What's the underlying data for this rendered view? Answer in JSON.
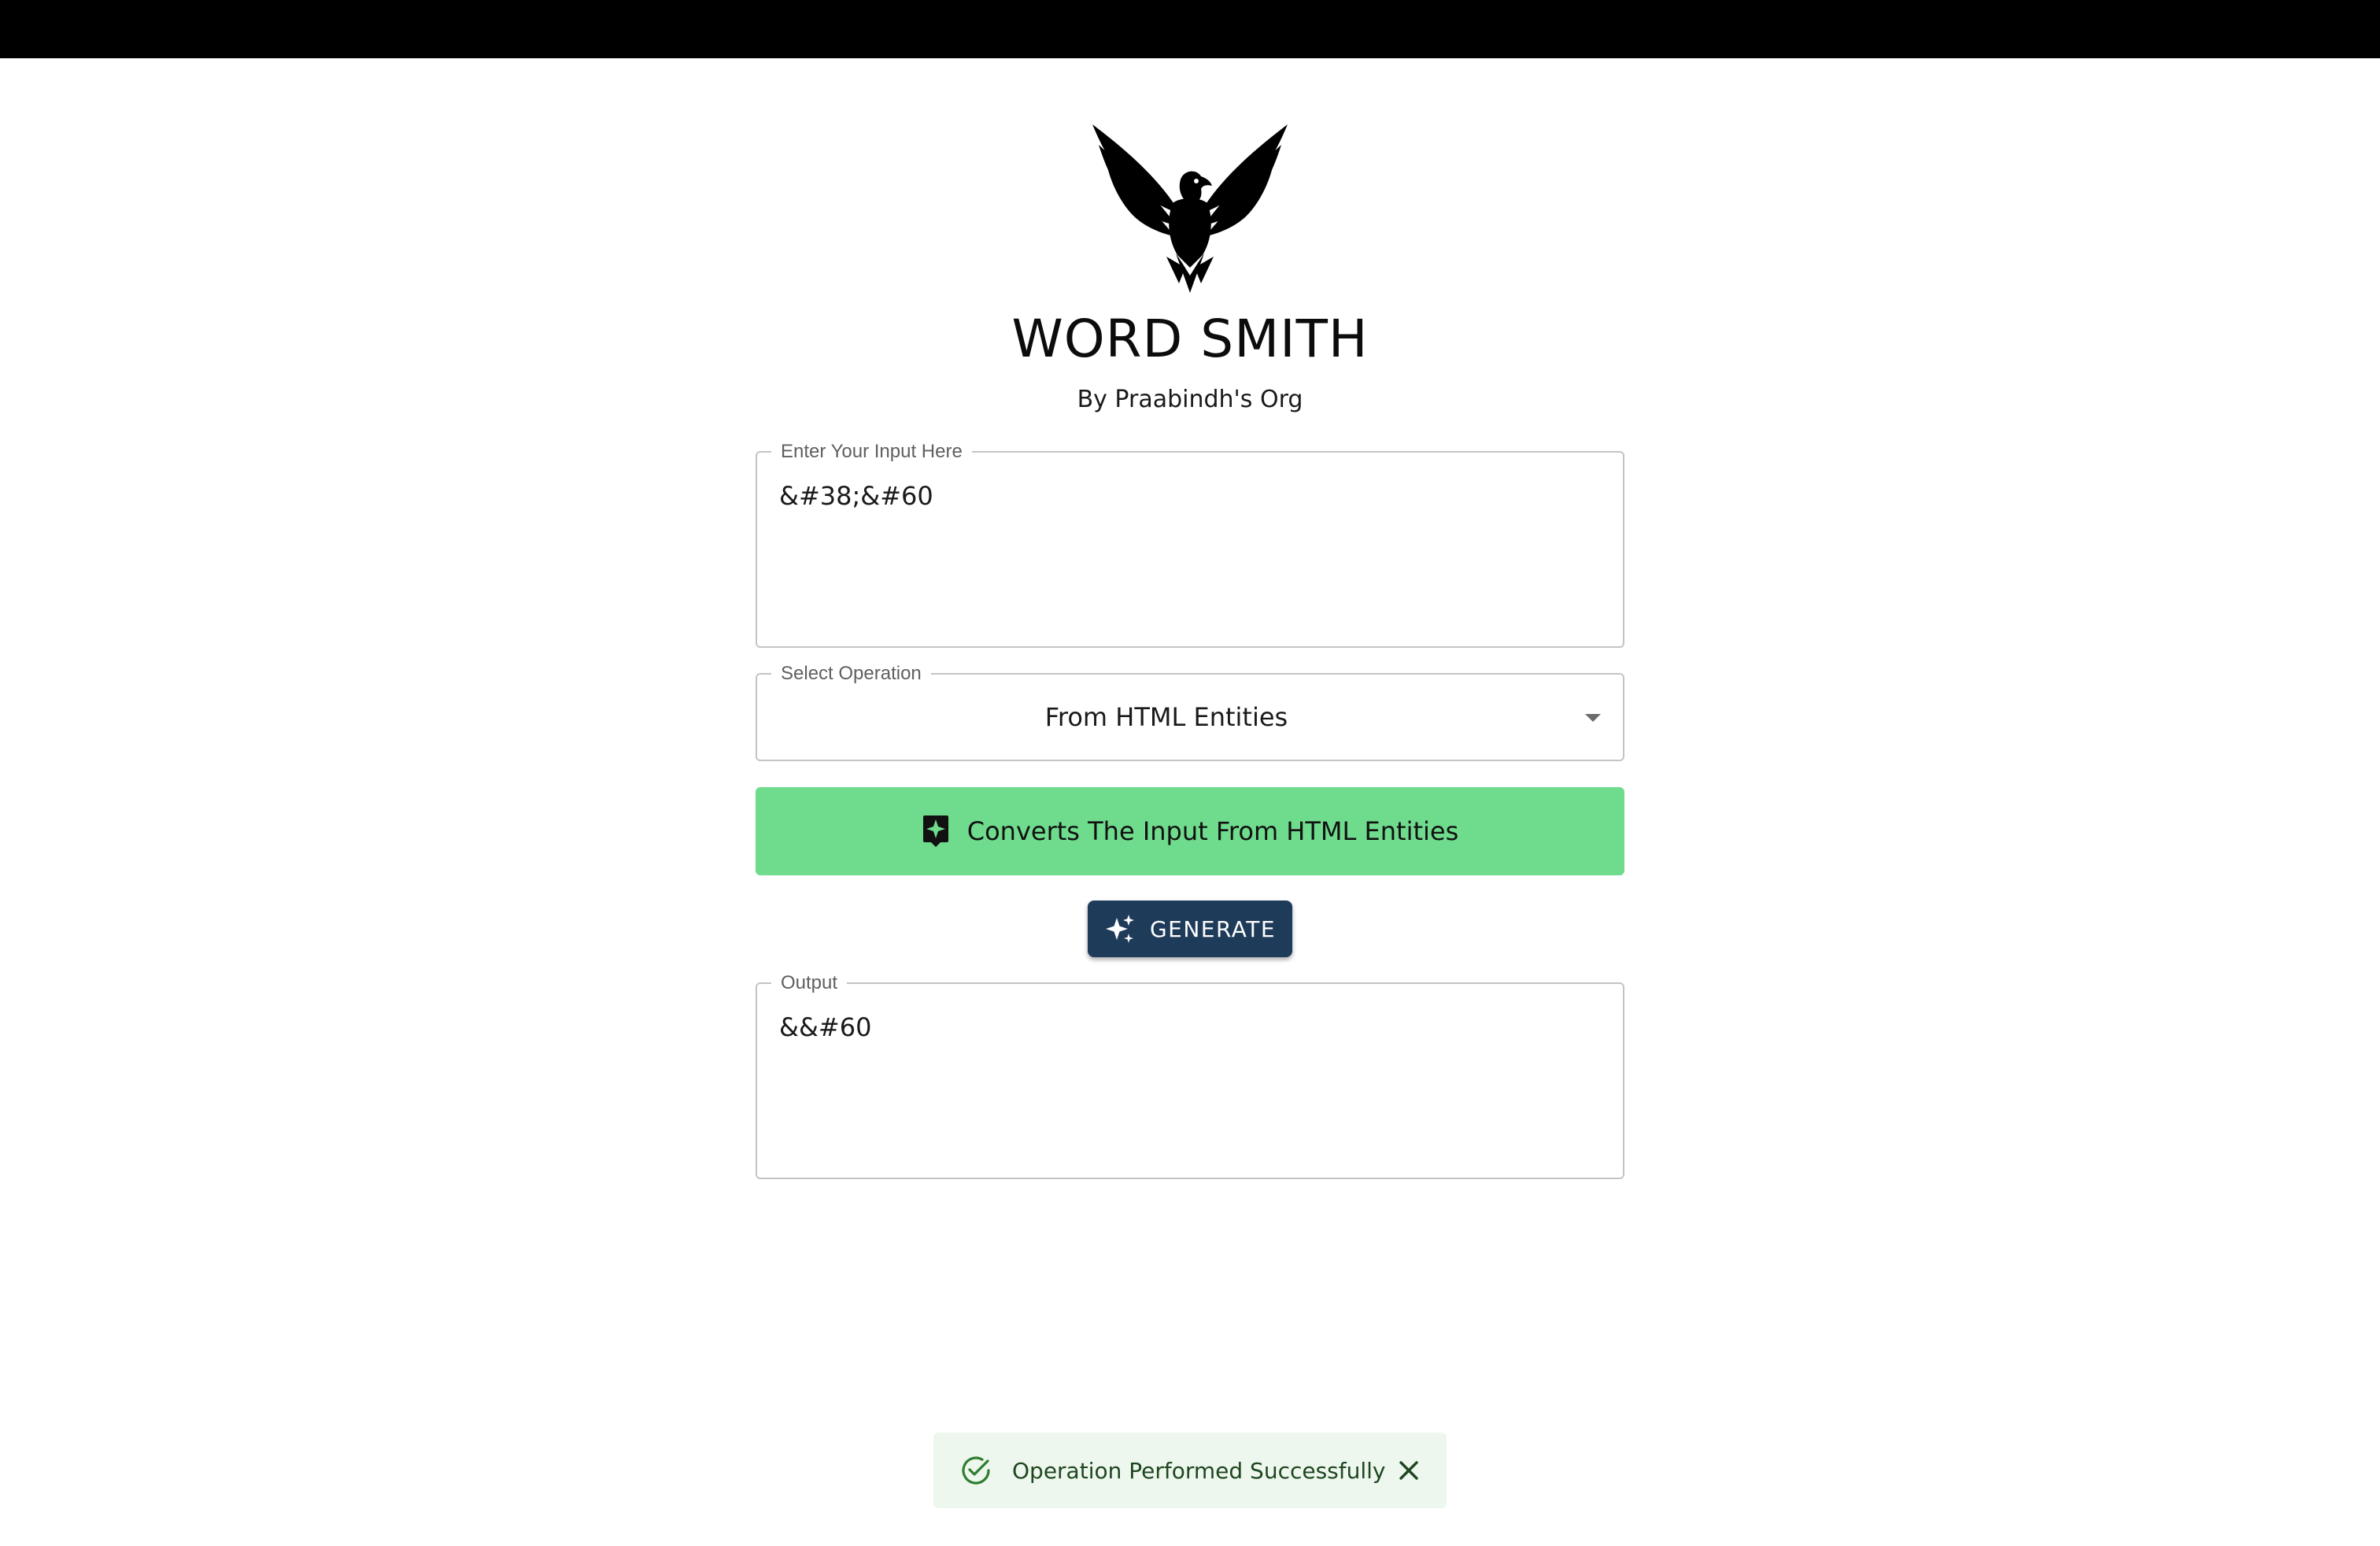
{
  "app": {
    "title": "WORD SMITH",
    "subtitle": "By Praabindh's Org"
  },
  "input": {
    "label": "Enter Your Input Here",
    "value": "&#38;&#60"
  },
  "operation": {
    "label": "Select Operation",
    "selected": "From HTML Entities"
  },
  "info": {
    "text": "Converts The Input From HTML Entities"
  },
  "generate": {
    "label": "GENERATE"
  },
  "output": {
    "label": "Output",
    "value": "&&#60"
  },
  "snackbar": {
    "message": "Operation Performed Successfully"
  },
  "colors": {
    "info_bar": "#6fdb8d",
    "generate_button": "#1f3b5a",
    "snackbar_bg": "#edf7ed",
    "snackbar_icon": "#2e7d32"
  },
  "icons": {
    "logo": "eagle-logo",
    "info": "sparkle-badge-icon",
    "generate": "sparkles-icon",
    "success": "check-circle-icon",
    "close": "close-icon",
    "dropdown": "caret-down-icon"
  }
}
